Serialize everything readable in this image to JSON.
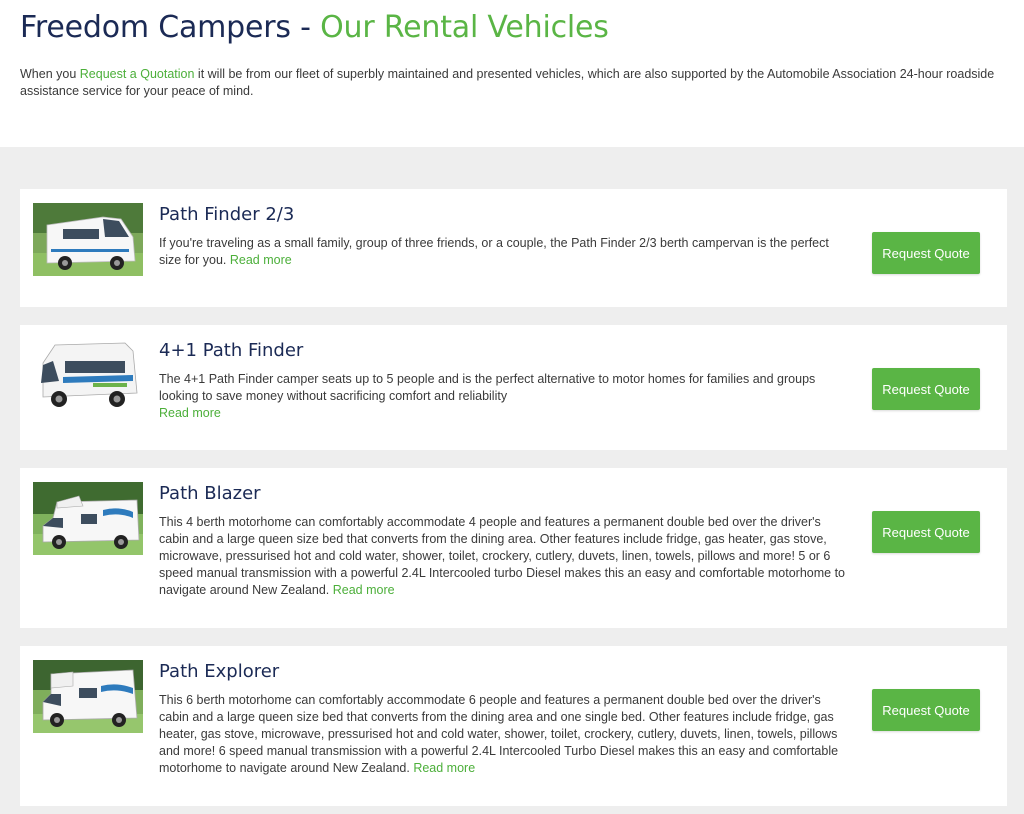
{
  "header": {
    "title_main": "Freedom Campers - ",
    "title_accent": "Our Rental Vehicles",
    "intro_before": "When you ",
    "intro_link": "Request a Quotation",
    "intro_after": " it will be from our fleet of superbly maintained and presented vehicles, which are also supported by the Automobile Association 24-hour roadside assistance service for your peace of mind."
  },
  "vehicles": [
    {
      "name": "Path Finder 2/3",
      "description": "If you're traveling as a small family, group of three friends, or a couple, the Path Finder 2/3 berth campervan is the perfect size for you.",
      "read_more": "Read more",
      "button": "Request Quote"
    },
    {
      "name": "4+1 Path Finder",
      "description": "The 4+1 Path Finder camper seats up to 5 people and is the perfect alternative to motor homes for families and groups looking to save money without sacrificing comfort and reliability",
      "read_more": "Read more",
      "button": "Request Quote"
    },
    {
      "name": "Path Blazer",
      "description": "This 4 berth motorhome can comfortably accommodate 4 people and features a permanent double bed over the driver's cabin and a large queen size bed that converts from the dining area. Other features include fridge, gas heater, gas stove, microwave, pressurised hot and cold water, shower, toilet, crockery, cutlery, duvets, linen, towels, pillows and more! 5 or 6 speed manual transmission with a powerful 2.4L Intercooled turbo Diesel makes this an easy and comfortable motorhome to navigate around New Zealand.",
      "read_more": "Read more",
      "button": "Request Quote"
    },
    {
      "name": "Path Explorer",
      "description": "This 6 berth motorhome can comfortably accommodate 6 people and features a permanent double bed over the driver's cabin and a large queen size bed that converts from the dining area and one single bed. Other features include fridge, gas heater, gas stove, microwave, pressurised hot and cold water, shower, toilet, crockery, cutlery, duvets, linen, towels, pillows and more! 6 speed manual transmission with a powerful 2.4L Intercooled Turbo Diesel makes this an easy and comfortable motorhome to navigate around New Zealand.",
      "read_more": "Read more",
      "button": "Request Quote"
    }
  ],
  "colors": {
    "brand_navy": "#1b2a55",
    "brand_green": "#5ab545",
    "background": "#eeeeee"
  }
}
